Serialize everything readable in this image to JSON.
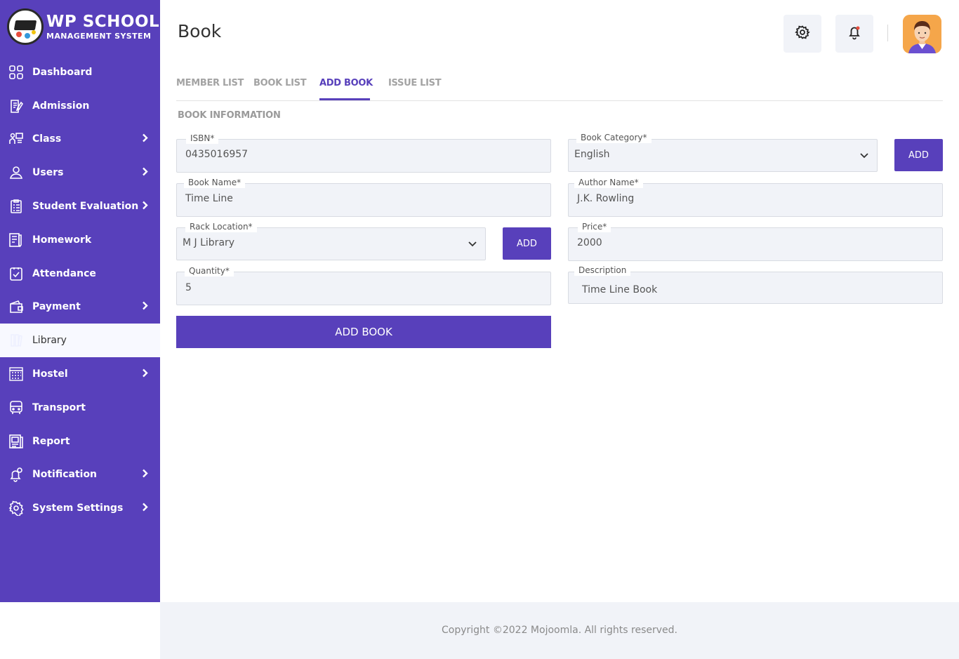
{
  "app": {
    "logo_title": "WP SCHOOL",
    "logo_subtitle": "MANAGEMENT SYSTEM",
    "accent_color": "#5840bb"
  },
  "sidebar": {
    "items": [
      {
        "label": "Dashboard",
        "icon": "dashboard-icon",
        "has_submenu": false
      },
      {
        "label": "Admission",
        "icon": "admission-icon",
        "has_submenu": false
      },
      {
        "label": "Class",
        "icon": "class-icon",
        "has_submenu": true
      },
      {
        "label": "Users",
        "icon": "user-icon",
        "has_submenu": true
      },
      {
        "label": "Student Evaluation",
        "icon": "evaluation-icon",
        "has_submenu": true
      },
      {
        "label": "Homework",
        "icon": "homework-icon",
        "has_submenu": false
      },
      {
        "label": "Attendance",
        "icon": "attendance-icon",
        "has_submenu": false
      },
      {
        "label": "Payment",
        "icon": "wallet-icon",
        "has_submenu": true
      },
      {
        "label": "Library",
        "icon": "library-icon",
        "has_submenu": false,
        "active": true
      },
      {
        "label": "Hostel",
        "icon": "hostel-icon",
        "has_submenu": true
      },
      {
        "label": "Transport",
        "icon": "bus-icon",
        "has_submenu": false
      },
      {
        "label": "Report",
        "icon": "report-icon",
        "has_submenu": false
      },
      {
        "label": "Notification",
        "icon": "notification-icon",
        "has_submenu": true
      },
      {
        "label": "System Settings",
        "icon": "settings-icon",
        "has_submenu": true
      }
    ]
  },
  "header": {
    "title": "Book"
  },
  "tabs": {
    "member_list": "MEMBER LIST",
    "book_list": "BOOK LIST",
    "add_book": "ADD BOOK",
    "issue_list": "ISSUE LIST",
    "active": "ADD BOOK"
  },
  "form": {
    "section_title": "BOOK INFORMATION",
    "isbn": {
      "label": "ISBN*",
      "value": "0435016957"
    },
    "book_category": {
      "label": "Book Category*",
      "value": "English"
    },
    "category_add_button": "ADD",
    "book_name": {
      "label": "Book Name*",
      "value": "Time Line"
    },
    "author_name": {
      "label": "Author Name*",
      "value": "J.K. Rowling"
    },
    "rack_location": {
      "label": "Rack Location*",
      "value": "M J Library"
    },
    "rack_add_button": "ADD",
    "price": {
      "label": "Price*",
      "value": "2000"
    },
    "quantity": {
      "label": "Quantity*",
      "value": "5"
    },
    "description": {
      "label": "Description",
      "value": "Time Line Book"
    },
    "submit_button": "ADD BOOK"
  },
  "footer": {
    "text": "Copyright ©2022 Mojoomla. All rights reserved."
  }
}
